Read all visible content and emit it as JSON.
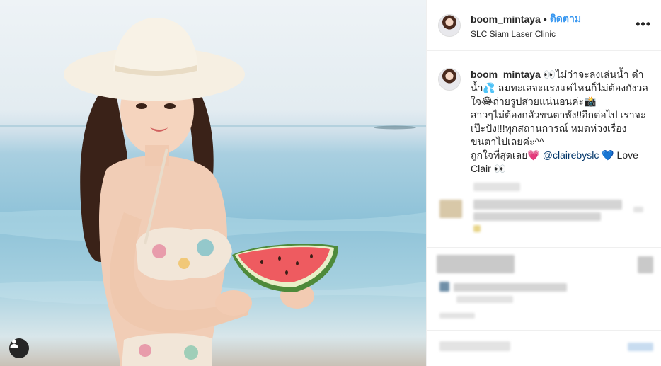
{
  "post": {
    "username": "boom_mintaya",
    "separator": "•",
    "follow_label": "ติดตาม",
    "location": "SLC Siam Laser Clinic",
    "more_icon": "•••",
    "caption_user": "boom_mintaya",
    "caption_text": "👀ไม่ว่าจะลงเล่นน้ำ ดำน้ำ💦 ลมทะเลจะแรงแค่ไหนก็ไม่ต้องกังวลใจ😂ถ่ายรูปสวยแน่นอนค่ะ📸\nสาวๆไม่ต้องกลัวขนตาพัง!!อีกต่อไป เราจะเป๊ะปัง!!!ทุกสถานการณ์ หมดห่วงเรื่องขนตาไปเลยค่ะ^^\nถูกใจที่สุดเลย💗 ",
    "mention": "@clairebyslc",
    "caption_tail": " 💙 Love Clair 👀"
  },
  "icons": {
    "user_tag": "user-tag-icon",
    "more": "more-options-icon"
  },
  "colors": {
    "follow": "#3897f0",
    "mention": "#003569",
    "text": "#262626",
    "divider": "#efefef"
  }
}
